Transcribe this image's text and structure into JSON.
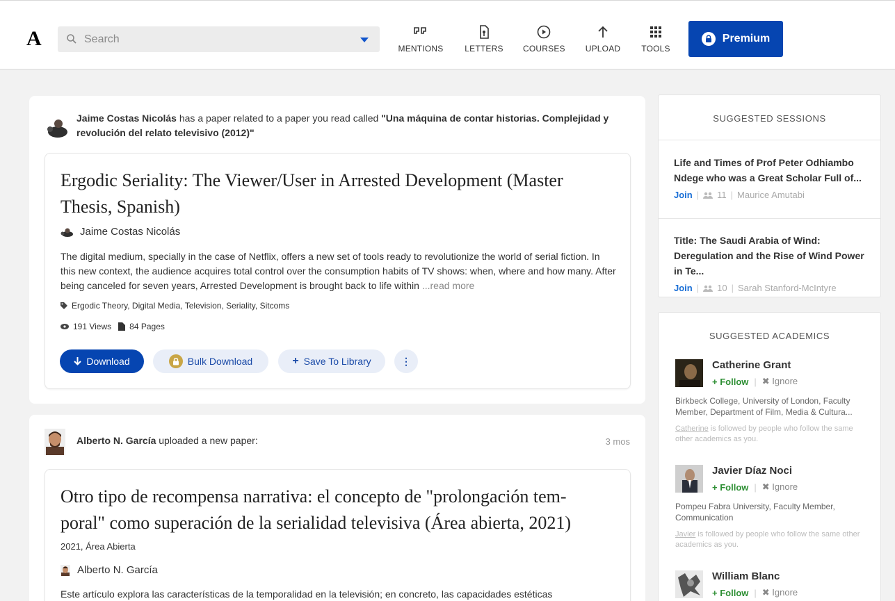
{
  "header": {
    "logo": "A",
    "search_placeholder": "Search",
    "nav": [
      {
        "label": "MENTIONS",
        "icon": "quote-icon"
      },
      {
        "label": "LETTERS",
        "icon": "letter-icon"
      },
      {
        "label": "COURSES",
        "icon": "play-circle-icon"
      },
      {
        "label": "UPLOAD",
        "icon": "upload-arrow-icon"
      },
      {
        "label": "TOOLS",
        "icon": "grid-icon"
      }
    ],
    "premium_label": "Premium",
    "colors": {
      "accent": "#0645b1"
    }
  },
  "feed": [
    {
      "actor": "Jaime Costas Nicolás",
      "action": " has a paper related to a paper you read called ",
      "related_title": "\"Una máquina de contar historias. Complejidad y revolución del relato televisivo (2012)\"",
      "title": "Ergodic Seriality: The Viewer/User in Arrested Development (Master Thesis, Spanish)",
      "author": "Jaime Costas Nicolás",
      "abstract": "The digital medium, specially in the case of Netflix, offers a new set of tools ready to revolutionize the world of serial fiction. In this new context, the audience acquires total control over the consumption habits of TV shows: when, where and how many. After being canceled for seven years, Arrested Development is brought back to life within ",
      "read_more": "...read more",
      "tags": "Ergodic Theory, Digital Media, Television, Seriality, Sitcoms",
      "views": "191 Views",
      "pages": "84 Pages",
      "buttons": {
        "download": "Download",
        "bulk": "Bulk Download",
        "save": "Save To Library"
      }
    },
    {
      "actor": "Alberto N. García",
      "action": " uploaded a new paper:",
      "time": "3 mos",
      "title": "Otro tipo de recompensa narrativa: el concepto de \"prolongación temporal\" como superación de la serialidad televisiva (Área abierta, 2021)",
      "title_line1": "Otro tipo de recompensa narrativa: el concepto de \"prolongación tem-",
      "title_line2": "poral\" como superación de la serialidad televisiva (Área abierta, 2021)",
      "pubinfo": "2021, Área Abierta",
      "author": "Alberto N. García",
      "abstract": "Este artículo explora las características de la temporalidad en la televisión; en concreto, las capacidades estéticas"
    }
  ],
  "sessions": {
    "heading": "SUGGESTED SESSIONS",
    "items": [
      {
        "title": "Life and Times of Prof Peter Odhiambo Ndege who was a Great Scholar Full of...",
        "join": "Join",
        "count": "11",
        "host": "Maurice Amutabi"
      },
      {
        "title": "Title: The Saudi Arabia of Wind: Deregulation and the Rise of Wind Power in Te...",
        "join": "Join",
        "count": "10",
        "host": "Sarah Stanford-McIntyre"
      }
    ]
  },
  "academics": {
    "heading": "SUGGESTED ACADEMICS",
    "follow": "Follow",
    "ignore": "Ignore",
    "items": [
      {
        "name": "Catherine Grant",
        "affiliation": "Birkbeck College, University of London, Faculty Member, Department of Film, Media & Cultura...",
        "why_name": "Catherine",
        "why": " is followed by people who follow the same other academics as you."
      },
      {
        "name": "Javier Díaz Noci",
        "affiliation": "Pompeu Fabra University, Faculty Member, Communication",
        "why_name": "Javier",
        "why": " is followed by people who follow the same other academics as you."
      },
      {
        "name": "William Blanc"
      }
    ]
  }
}
